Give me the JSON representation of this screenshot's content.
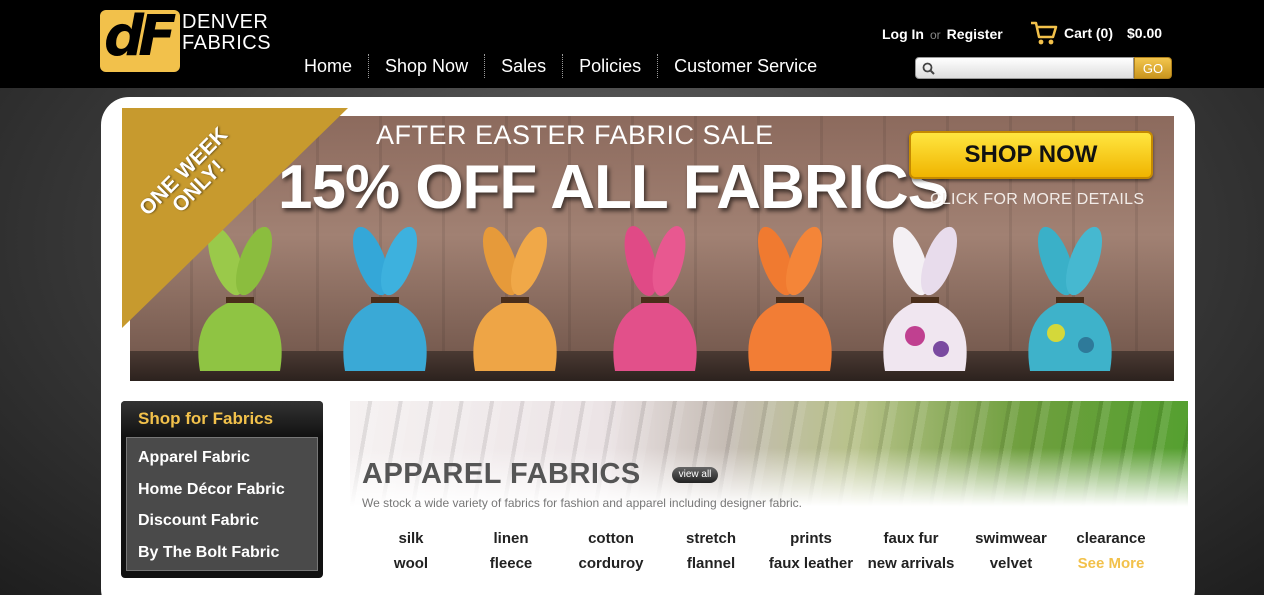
{
  "logo": {
    "mark": "dF",
    "line1": "DENVER",
    "line2": "FABRICS"
  },
  "nav": [
    {
      "label": "Home"
    },
    {
      "label": "Shop Now"
    },
    {
      "label": "Sales"
    },
    {
      "label": "Policies"
    },
    {
      "label": "Customer Service"
    }
  ],
  "account": {
    "login": "Log In",
    "or": "or",
    "register": "Register"
  },
  "cart": {
    "label": "Cart (0)",
    "total": "$0.00"
  },
  "search": {
    "placeholder": "",
    "button": "GO"
  },
  "banner": {
    "ribbon": "ONE WEEK ONLY!",
    "subtitle": "AFTER EASTER FABRIC SALE",
    "headline": "15% OFF ALL FABRICS",
    "cta": "SHOP NOW",
    "details": "CLICK FOR MORE DETAILS"
  },
  "sidebar": {
    "title": "Shop for Fabrics",
    "items": [
      {
        "label": "Apparel Fabric"
      },
      {
        "label": "Home Décor Fabric"
      },
      {
        "label": "Discount Fabric"
      },
      {
        "label": "By The Bolt Fabric"
      }
    ]
  },
  "apparel": {
    "title": "APPAREL FABRICS",
    "view_all": "view all",
    "description": "We stock a wide variety of fabrics for fashion and apparel including designer fabric.",
    "categories": [
      "silk",
      "linen",
      "cotton",
      "stretch",
      "prints",
      "faux fur",
      "swimwear",
      "clearance",
      "wool",
      "fleece",
      "corduroy",
      "flannel",
      "faux leather",
      "new arrivals",
      "velvet",
      "See More"
    ]
  },
  "colors": {
    "accent": "#f2c14b",
    "header_bg": "#000000",
    "cta_yellow": "#ffe640"
  }
}
